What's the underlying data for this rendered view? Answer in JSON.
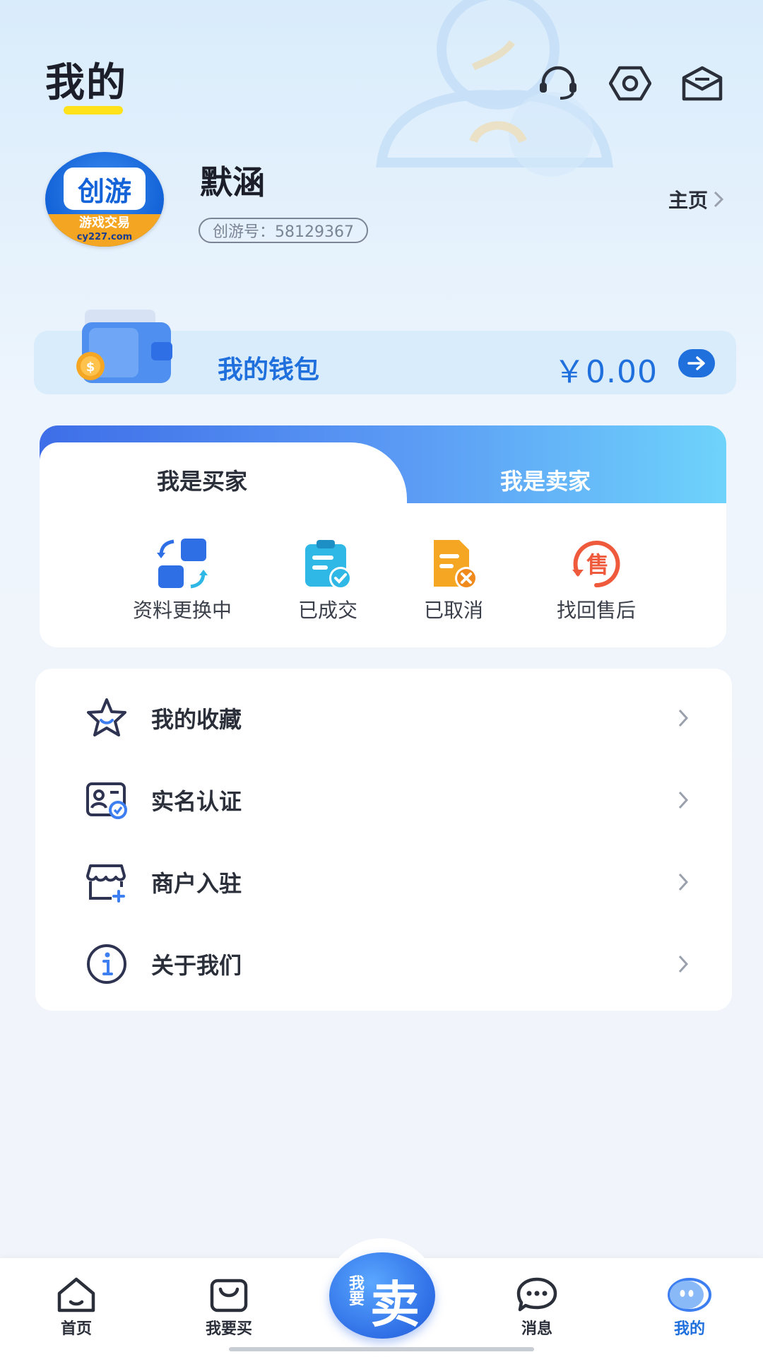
{
  "header": {
    "title": "我的",
    "icons": [
      "headset-icon",
      "settings-icon",
      "mail-icon"
    ]
  },
  "profile": {
    "username": "默涵",
    "uid": "创游号：58129367",
    "homepage_link": "主页",
    "avatar_logo": {
      "main": "创游",
      "sub": "游戏交易",
      "url": "cy227.com"
    }
  },
  "wallet": {
    "label": "我的钱包",
    "amount": "￥0.00"
  },
  "roles": {
    "active_tab": "我是买家",
    "tabs": [
      "我是买家",
      "我是卖家"
    ],
    "items": [
      {
        "label": "资料更换中",
        "icon": "swap-icon",
        "color": "#2f6fe6"
      },
      {
        "label": "已成交",
        "icon": "clipboard-check-icon",
        "color": "#2fb7e6"
      },
      {
        "label": "已取消",
        "icon": "document-cancel-icon",
        "color": "#f5a623"
      },
      {
        "label": "找回售后",
        "icon": "after-sale-icon",
        "color": "#ef5a3c"
      }
    ]
  },
  "menu": [
    {
      "label": "我的收藏",
      "icon": "star-icon"
    },
    {
      "label": "实名认证",
      "icon": "id-card-icon"
    },
    {
      "label": "商户入驻",
      "icon": "store-icon"
    },
    {
      "label": "关于我们",
      "icon": "info-icon"
    }
  ],
  "bottom_nav": {
    "items": [
      {
        "label": "首页",
        "icon": "home-icon"
      },
      {
        "label": "我要买",
        "icon": "shopping-bag-icon"
      },
      {
        "label": "消息",
        "icon": "message-icon"
      },
      {
        "label": "我的",
        "icon": "profile-icon"
      }
    ],
    "sell_button": {
      "small": "我要",
      "big": "卖"
    },
    "active": "我的"
  },
  "colors": {
    "accent": "#1f6fdc",
    "title_underline": "#ffe21a",
    "background_top": "#d9ecfb",
    "background": "#f1f5fb"
  }
}
